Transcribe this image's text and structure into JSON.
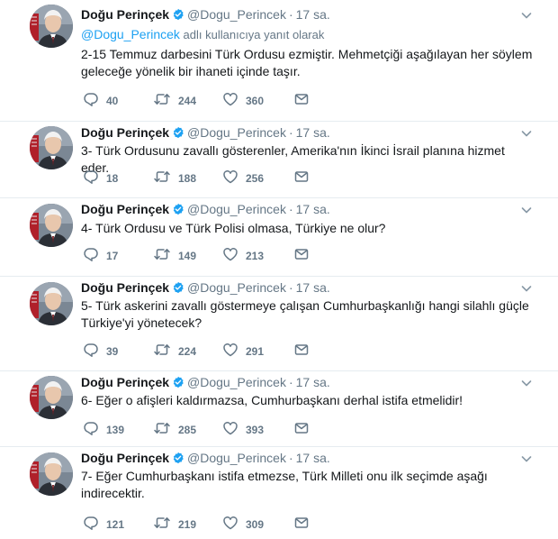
{
  "colors": {
    "accent": "#1da1f2",
    "text": "#14171a",
    "secondary_text": "#657786",
    "divider": "#e6ecf0"
  },
  "icons": {
    "verified": "verified-badge-icon",
    "caret": "chevron-down-icon",
    "reply": "reply-bubble-icon",
    "retweet": "retweet-icon",
    "like": "heart-icon",
    "dm": "envelope-icon"
  },
  "tweets": [
    {
      "fullname": "Doğu Perinçek",
      "handle": "@Dogu_Perincek",
      "time": "17 sa.",
      "reply_to_mention": "@Dogu_Perincek",
      "reply_to_suffix": " adlı kullanıcıya yanıt olarak",
      "text": "2-15 Temmuz darbesini Türk Ordusu ezmiştir. Mehmetçiği aşağılayan her söylem geleceğe yönelik bir ihaneti içinde taşır.",
      "replies": "40",
      "retweets": "244",
      "likes": "360"
    },
    {
      "fullname": "Doğu Perinçek",
      "handle": "@Dogu_Perincek",
      "time": "17 sa.",
      "text": "3- Türk Ordusunu zavallı gösterenler, Amerika'nın İkinci İsrail planına hizmet eder.",
      "replies": "18",
      "retweets": "188",
      "likes": "256"
    },
    {
      "fullname": "Doğu Perinçek",
      "handle": "@Dogu_Perincek",
      "time": "17 sa.",
      "text": "4- Türk Ordusu ve Türk Polisi olmasa, Türkiye ne olur?",
      "replies": "17",
      "retweets": "149",
      "likes": "213"
    },
    {
      "fullname": "Doğu Perinçek",
      "handle": "@Dogu_Perincek",
      "time": "17 sa.",
      "text": "5- Türk askerini zavallı göstermeye çalışan Cumhurbaşkanlığı hangi silahlı güçle Türkiye'yi yönetecek?",
      "replies": "39",
      "retweets": "224",
      "likes": "291"
    },
    {
      "fullname": "Doğu Perinçek",
      "handle": "@Dogu_Perincek",
      "time": "17 sa.",
      "text": "6- Eğer o afişleri kaldırmazsa, Cumhurbaşkanı derhal istifa etmelidir!",
      "replies": "139",
      "retweets": "285",
      "likes": "393"
    },
    {
      "fullname": "Doğu Perinçek",
      "handle": "@Dogu_Perincek",
      "time": "17 sa.",
      "text": "7- Eğer Cumhurbaşkanı istifa etmezse, Türk Milleti onu ilk seçimde aşağı indirecektir.",
      "replies": "121",
      "retweets": "219",
      "likes": "309"
    }
  ]
}
